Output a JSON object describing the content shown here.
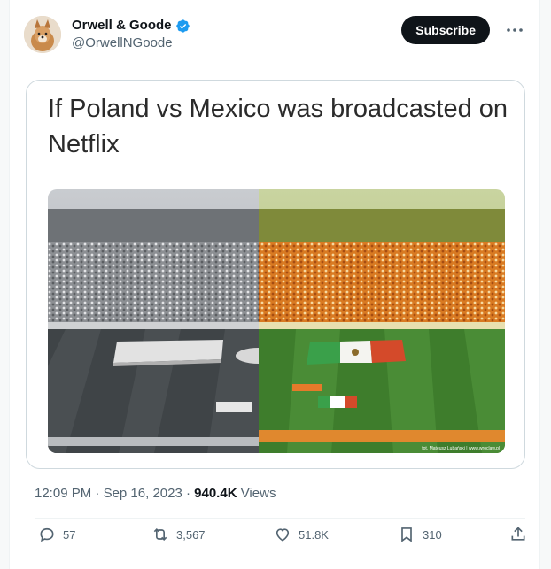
{
  "author": {
    "display_name": "Orwell & Goode",
    "handle": "@OrwellNGoode",
    "verified_color": "#1d9bf0"
  },
  "header": {
    "subscribe_label": "Subscribe",
    "more_icon": "more-icon"
  },
  "media": {
    "caption": "If Poland vs Mexico was broadcasted on Netflix",
    "photo_credit": "fot. Mateusz Lubański | www.wroclaw.pl",
    "left_half_tone": "grayscale",
    "right_half_tone": "orange-green"
  },
  "meta": {
    "time": "12:09 PM",
    "sep1": " · ",
    "date": "Sep 16, 2023",
    "sep2": " · ",
    "views_count": "940.4K",
    "views_label": " Views"
  },
  "actions": {
    "reply_count": "57",
    "retweet_count": "3,567",
    "like_count": "51.8K",
    "bookmark_count": "310"
  },
  "colors": {
    "text_primary": "#0f1419",
    "text_secondary": "#536471",
    "border": "#cfd9de"
  }
}
